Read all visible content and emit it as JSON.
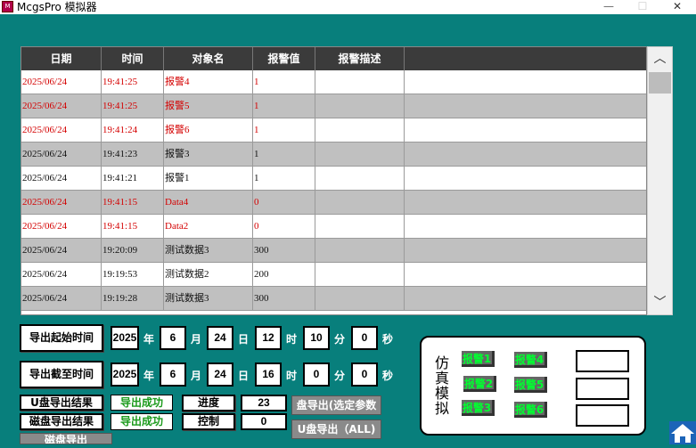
{
  "window": {
    "title": "McgsPro 模拟器",
    "icon": "app-icon",
    "min": "—",
    "max": "☐",
    "close": "✕"
  },
  "table": {
    "columns": [
      "日期",
      "时间",
      "对象名",
      "报警值",
      "报警描述"
    ],
    "rows": [
      {
        "date": "2025/06/24",
        "time": "19:41:25",
        "name": "报警4",
        "value": "1",
        "desc": "",
        "color": "#d40000"
      },
      {
        "date": "2025/06/24",
        "time": "19:41:25",
        "name": "报警5",
        "value": "1",
        "desc": "",
        "color": "#d40000"
      },
      {
        "date": "2025/06/24",
        "time": "19:41:24",
        "name": "报警6",
        "value": "1",
        "desc": "",
        "color": "#d40000"
      },
      {
        "date": "2025/06/24",
        "time": "19:41:23",
        "name": "报警3",
        "value": "1",
        "desc": "",
        "color": "#111111"
      },
      {
        "date": "2025/06/24",
        "time": "19:41:21",
        "name": "报警1",
        "value": "1",
        "desc": "",
        "color": "#111111"
      },
      {
        "date": "2025/06/24",
        "time": "19:41:15",
        "name": "Data4",
        "value": "0",
        "desc": "",
        "color": "#d40000"
      },
      {
        "date": "2025/06/24",
        "time": "19:41:15",
        "name": "Data2",
        "value": "0",
        "desc": "",
        "color": "#d40000"
      },
      {
        "date": "2025/06/24",
        "time": "19:20:09",
        "name": "测试数据3",
        "value": "300",
        "desc": "",
        "color": "#111111"
      },
      {
        "date": "2025/06/24",
        "time": "19:19:53",
        "name": "测试数据2",
        "value": "200",
        "desc": "",
        "color": "#111111"
      },
      {
        "date": "2025/06/24",
        "time": "19:19:28",
        "name": "测试数据3",
        "value": "300",
        "desc": "",
        "color": "#111111"
      }
    ]
  },
  "scrollbar": {
    "up": "︿",
    "down": "﹀"
  },
  "export_start": {
    "label": "导出起始时间",
    "year": "2025",
    "year_unit": "年",
    "month": "6",
    "month_unit": "月",
    "day": "24",
    "day_unit": "日",
    "hour": "12",
    "hour_unit": "时",
    "minute": "10",
    "minute_unit": "分",
    "second": "0",
    "second_unit": "秒"
  },
  "export_end": {
    "label": "导出截至时间",
    "year": "2025",
    "year_unit": "年",
    "month": "6",
    "month_unit": "月",
    "day": "24",
    "day_unit": "日",
    "hour": "16",
    "hour_unit": "时",
    "minute": "0",
    "minute_unit": "分",
    "second": "0",
    "second_unit": "秒"
  },
  "status": {
    "u_label": "U盘导出结果",
    "u_result": "导出成功",
    "disk_label": "磁盘导出结果",
    "disk_result": "导出成功",
    "progress_label": "进度",
    "progress_value": "23",
    "control_label": "控制",
    "control_value": "0",
    "export_selected": "盘导出(选定参数",
    "export_all": "U盘导出（ALL)",
    "disk_export": "磁盘导出"
  },
  "sim": {
    "label": "仿真模拟",
    "buttons": [
      "报警1",
      "报警2",
      "报警3",
      "报警4",
      "报警5",
      "报警6"
    ]
  },
  "home_icon": "home-icon",
  "colors": {
    "background": "#087f7c",
    "header": "#3b3b3b",
    "alarm_red": "#d40000",
    "ok_green": "#1a9a1a",
    "sim_green": "#00ff30"
  }
}
